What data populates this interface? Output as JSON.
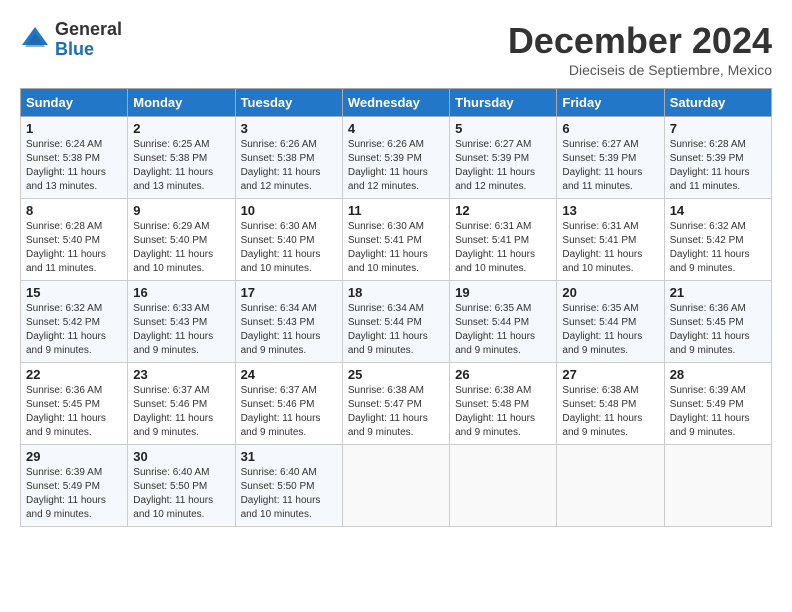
{
  "header": {
    "logo_general": "General",
    "logo_blue": "Blue",
    "month_title": "December 2024",
    "subtitle": "Dieciseis de Septiembre, Mexico"
  },
  "days_of_week": [
    "Sunday",
    "Monday",
    "Tuesday",
    "Wednesday",
    "Thursday",
    "Friday",
    "Saturday"
  ],
  "weeks": [
    [
      {
        "day": "1",
        "sunrise": "6:24 AM",
        "sunset": "5:38 PM",
        "daylight": "11 hours and 13 minutes."
      },
      {
        "day": "2",
        "sunrise": "6:25 AM",
        "sunset": "5:38 PM",
        "daylight": "11 hours and 13 minutes."
      },
      {
        "day": "3",
        "sunrise": "6:26 AM",
        "sunset": "5:38 PM",
        "daylight": "11 hours and 12 minutes."
      },
      {
        "day": "4",
        "sunrise": "6:26 AM",
        "sunset": "5:39 PM",
        "daylight": "11 hours and 12 minutes."
      },
      {
        "day": "5",
        "sunrise": "6:27 AM",
        "sunset": "5:39 PM",
        "daylight": "11 hours and 12 minutes."
      },
      {
        "day": "6",
        "sunrise": "6:27 AM",
        "sunset": "5:39 PM",
        "daylight": "11 hours and 11 minutes."
      },
      {
        "day": "7",
        "sunrise": "6:28 AM",
        "sunset": "5:39 PM",
        "daylight": "11 hours and 11 minutes."
      }
    ],
    [
      {
        "day": "8",
        "sunrise": "6:28 AM",
        "sunset": "5:40 PM",
        "daylight": "11 hours and 11 minutes."
      },
      {
        "day": "9",
        "sunrise": "6:29 AM",
        "sunset": "5:40 PM",
        "daylight": "11 hours and 10 minutes."
      },
      {
        "day": "10",
        "sunrise": "6:30 AM",
        "sunset": "5:40 PM",
        "daylight": "11 hours and 10 minutes."
      },
      {
        "day": "11",
        "sunrise": "6:30 AM",
        "sunset": "5:41 PM",
        "daylight": "11 hours and 10 minutes."
      },
      {
        "day": "12",
        "sunrise": "6:31 AM",
        "sunset": "5:41 PM",
        "daylight": "11 hours and 10 minutes."
      },
      {
        "day": "13",
        "sunrise": "6:31 AM",
        "sunset": "5:41 PM",
        "daylight": "11 hours and 10 minutes."
      },
      {
        "day": "14",
        "sunrise": "6:32 AM",
        "sunset": "5:42 PM",
        "daylight": "11 hours and 9 minutes."
      }
    ],
    [
      {
        "day": "15",
        "sunrise": "6:32 AM",
        "sunset": "5:42 PM",
        "daylight": "11 hours and 9 minutes."
      },
      {
        "day": "16",
        "sunrise": "6:33 AM",
        "sunset": "5:43 PM",
        "daylight": "11 hours and 9 minutes."
      },
      {
        "day": "17",
        "sunrise": "6:34 AM",
        "sunset": "5:43 PM",
        "daylight": "11 hours and 9 minutes."
      },
      {
        "day": "18",
        "sunrise": "6:34 AM",
        "sunset": "5:44 PM",
        "daylight": "11 hours and 9 minutes."
      },
      {
        "day": "19",
        "sunrise": "6:35 AM",
        "sunset": "5:44 PM",
        "daylight": "11 hours and 9 minutes."
      },
      {
        "day": "20",
        "sunrise": "6:35 AM",
        "sunset": "5:44 PM",
        "daylight": "11 hours and 9 minutes."
      },
      {
        "day": "21",
        "sunrise": "6:36 AM",
        "sunset": "5:45 PM",
        "daylight": "11 hours and 9 minutes."
      }
    ],
    [
      {
        "day": "22",
        "sunrise": "6:36 AM",
        "sunset": "5:45 PM",
        "daylight": "11 hours and 9 minutes."
      },
      {
        "day": "23",
        "sunrise": "6:37 AM",
        "sunset": "5:46 PM",
        "daylight": "11 hours and 9 minutes."
      },
      {
        "day": "24",
        "sunrise": "6:37 AM",
        "sunset": "5:46 PM",
        "daylight": "11 hours and 9 minutes."
      },
      {
        "day": "25",
        "sunrise": "6:38 AM",
        "sunset": "5:47 PM",
        "daylight": "11 hours and 9 minutes."
      },
      {
        "day": "26",
        "sunrise": "6:38 AM",
        "sunset": "5:48 PM",
        "daylight": "11 hours and 9 minutes."
      },
      {
        "day": "27",
        "sunrise": "6:38 AM",
        "sunset": "5:48 PM",
        "daylight": "11 hours and 9 minutes."
      },
      {
        "day": "28",
        "sunrise": "6:39 AM",
        "sunset": "5:49 PM",
        "daylight": "11 hours and 9 minutes."
      }
    ],
    [
      {
        "day": "29",
        "sunrise": "6:39 AM",
        "sunset": "5:49 PM",
        "daylight": "11 hours and 9 minutes."
      },
      {
        "day": "30",
        "sunrise": "6:40 AM",
        "sunset": "5:50 PM",
        "daylight": "11 hours and 10 minutes."
      },
      {
        "day": "31",
        "sunrise": "6:40 AM",
        "sunset": "5:50 PM",
        "daylight": "11 hours and 10 minutes."
      },
      null,
      null,
      null,
      null
    ]
  ],
  "labels": {
    "sunrise_prefix": "Sunrise: ",
    "sunset_prefix": "Sunset: ",
    "daylight_prefix": "Daylight: "
  }
}
